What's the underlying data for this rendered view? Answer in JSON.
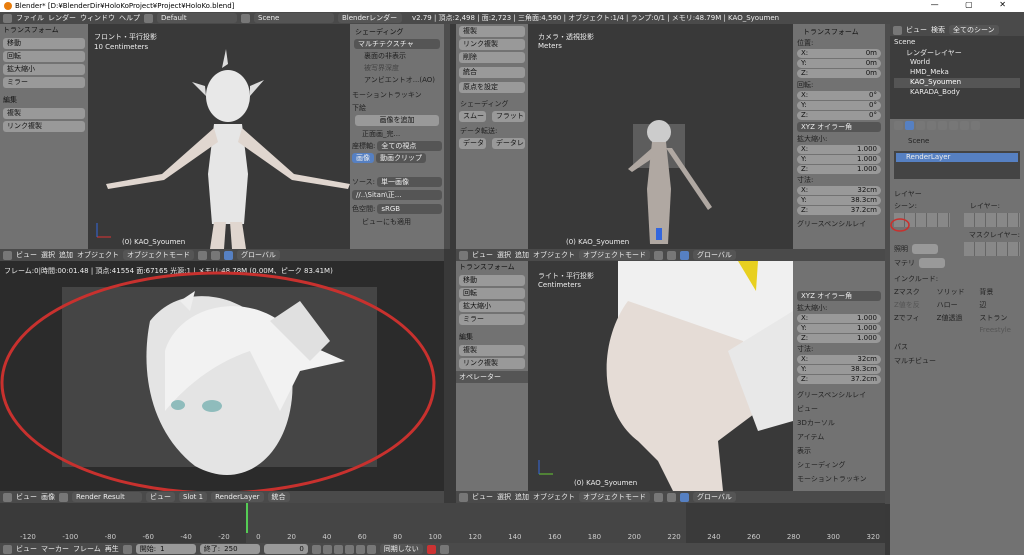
{
  "titlebar": {
    "title": "Blender* [D:¥BlenderDir¥HoloKoProject¥Project¥HoloKo.blend]"
  },
  "topbar": {
    "menus": [
      "ファイル",
      "レンダー",
      "ウィンドウ",
      "ヘルプ"
    ],
    "layout": "Default",
    "scene": "Scene",
    "engine": "Blenderレンダー",
    "stats": "v2.79 | 頂点:2,498 | 面:2,723 | 三角面:4,590 | オブジェクト:1/4 | ランプ:0/1 | メモリ:48.79M | KAO_Syoumen"
  },
  "tool_left": {
    "transform_header": "トランスフォーム",
    "transform_buttons": [
      "移動",
      "回転",
      "拡大縮小",
      "ミラー"
    ],
    "edit_header": "編集",
    "edit_buttons": [
      "複製",
      "リンク複製"
    ]
  },
  "vp_front": {
    "title": "フロント・平行投影",
    "scale": "10 Centimeters",
    "object": "(0) KAO_Syoumen"
  },
  "shading_panel": {
    "header": "シェーディング",
    "mode": "マルチテクスチャ",
    "checks": [
      "裏面の非表示",
      "被写界深度",
      "アンビエントオ...(AO)"
    ],
    "motion": "モーショントラッキン",
    "background": "下絵",
    "add_image": "画像を追加",
    "image_name": "正面画_完...",
    "axis_label": "座標軸:",
    "axis_value": "全ての視点",
    "tab_image": "画像",
    "tab_movie": "動画クリップ",
    "source_label": "ソース:",
    "source_value": "単一画像",
    "path": "//..\\Sitan\\正...",
    "colorspace_label": "色空間:",
    "colorspace_value": "sRGB",
    "apply_view": "ビューにも適用"
  },
  "mid_tool": {
    "buttons1": [
      "複製",
      "リンク複製",
      "削除"
    ],
    "buttons2": [
      "統合"
    ],
    "origin": "原点を設定",
    "shading_header": "シェーディング",
    "smooth": "スムー",
    "flat": "フラット",
    "data_transfer": "データ転送:",
    "data": "データ",
    "data_layout": "データレ"
  },
  "vp_camera": {
    "title": "カメラ・透視投影",
    "units": "Meters",
    "object": "(0) KAO_Syoumen"
  },
  "props_top": {
    "header": "トランスフォーム",
    "location": "位置:",
    "loc": [
      "X:",
      "0m",
      "Y:",
      "0m",
      "Z:",
      "0m"
    ],
    "rotation": "回転:",
    "rot": [
      "X:",
      "0°",
      "Y:",
      "0°",
      "Z:",
      "0°"
    ],
    "rotmode": "XYZ オイラー角",
    "scale": "拡大縮小:",
    "scl": [
      "X:",
      "1.000",
      "Y:",
      "1.000",
      "Z:",
      "1.000"
    ],
    "dims": "寸法:",
    "dim": [
      "X:",
      "32cm",
      "Y:",
      "38.3cm",
      "Z:",
      "37.2cm"
    ],
    "grease": "グリースペンシルレイ"
  },
  "outliner": {
    "tabs": [
      "ビュー",
      "検索",
      "全てのシーン"
    ],
    "items": [
      "Scene",
      "レンダーレイヤー",
      "World",
      "HMD_Meka",
      "KAO_Syoumen",
      "KARADA_Body"
    ]
  },
  "render_props": {
    "scene": "Scene",
    "layer_name": "RenderLayer",
    "layer_header": "レイヤー",
    "scene_label": "シーン:",
    "layer_label": "レイヤー:",
    "mask_label": "マスクレイヤー:",
    "light_label": "照明",
    "material_label": "マテリ",
    "include_label": "インクルード:",
    "checks": [
      "Zマスク",
      "ソリッド",
      "背景",
      "Z値を反",
      "ハロー",
      "辺",
      "Zでフィ",
      "Z値透過",
      "ストラン",
      "Freestyle"
    ],
    "pass": "パス",
    "multiview": "マルチビュー"
  },
  "header_left": {
    "items": [
      "ビュー",
      "選択",
      "追加",
      "オブジェクト"
    ],
    "mode": "オブジェクトモード",
    "pivot": "グローバル"
  },
  "header_mid": {
    "items": [
      "ビュー",
      "選択",
      "追加",
      "オブジェクト"
    ],
    "mode": "オブジェクトモード",
    "pivot": "グローバル"
  },
  "image_editor": {
    "info": "フレーム:0|時間:00:01.48 | 頂点:41554 面:67165 光源:1 | メモリ:48.78M (0.00M、ピーク 83.41M)",
    "menus": [
      "ビュー",
      "画像"
    ],
    "image": "Render Result",
    "view": "ビュー",
    "slot": "Slot 1",
    "layer": "RenderLayer",
    "pass": "統合"
  },
  "mid_tool2": {
    "transform_header": "トランスフォーム",
    "transform_buttons": [
      "移動",
      "回転",
      "拡大縮小",
      "ミラー"
    ],
    "edit_header": "編集",
    "edit_buttons": [
      "複製",
      "リンク複製"
    ],
    "operator": "オペレーター"
  },
  "vp_side": {
    "title": "ライト・平行投影",
    "units": "Centimeters",
    "object": "(0) KAO_Syoumen"
  },
  "props_bottom": {
    "rotmode": "XYZ オイラー角",
    "scale": "拡大縮小:",
    "scl": [
      "X:",
      "1.000",
      "Y:",
      "1.000",
      "Z:",
      "1.000"
    ],
    "dims": "寸法:",
    "dim": [
      "X:",
      "32cm",
      "Y:",
      "38.3cm",
      "Z:",
      "37.2cm"
    ],
    "panels": [
      "グリースペンシルレイ",
      "ビュー",
      "3Dカーソル",
      "アイテム",
      "表示",
      "シェーディング",
      "モーショントラッキン"
    ]
  },
  "header_bottom_right": {
    "items": [
      "ビュー",
      "選択",
      "追加",
      "オブジェクト"
    ],
    "mode": "オブジェクトモード",
    "pivot": "グローバル"
  },
  "timeline": {
    "ticks": [
      "-120",
      "-100",
      "-80",
      "-60",
      "-40",
      "-20",
      "0",
      "20",
      "40",
      "60",
      "80",
      "100",
      "120",
      "140",
      "160",
      "180",
      "200",
      "220",
      "240",
      "260",
      "280",
      "300",
      "320"
    ],
    "menus": [
      "ビュー",
      "マーカー",
      "フレーム",
      "再生"
    ],
    "start_label": "開始:",
    "start": "1",
    "end_label": "終了:",
    "end": "250",
    "current": "0",
    "sync": "同期しない"
  },
  "colors": {
    "annotation": "#c8312e"
  }
}
